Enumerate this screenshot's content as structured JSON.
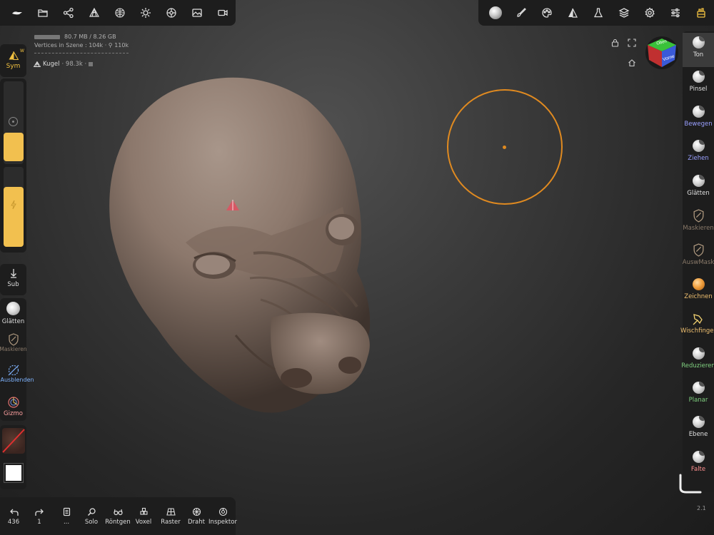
{
  "top_left_toolbar": [
    {
      "name": "logo-icon"
    },
    {
      "name": "folder-icon"
    },
    {
      "name": "scene-graph-icon"
    },
    {
      "name": "multires-icon"
    },
    {
      "name": "material-sphere-icon"
    },
    {
      "name": "light-icon"
    },
    {
      "name": "settings-wheel-icon"
    },
    {
      "name": "image-icon"
    },
    {
      "name": "video-icon"
    }
  ],
  "top_right_toolbar": [
    {
      "name": "matcap-sphere-icon"
    },
    {
      "name": "brush-icon"
    },
    {
      "name": "palette-icon"
    },
    {
      "name": "symmetry-icon"
    },
    {
      "name": "flask-icon"
    },
    {
      "name": "layers-icon"
    },
    {
      "name": "gear-icon"
    },
    {
      "name": "sliders-icon"
    },
    {
      "name": "tools-icon"
    }
  ],
  "info": {
    "memory": "80.7 MB / 8.26 GB",
    "vertices": "Vertices in Szene : 104k · ⚲ 110k"
  },
  "object": {
    "name": "Kugel",
    "count": "· 98.3k ·"
  },
  "sym": {
    "label": "Sym",
    "superscript": "W"
  },
  "slider_levels": {
    "radius_fraction": 0.55,
    "intensity_fraction": 0.75
  },
  "left_tools": [
    {
      "label": "Sub",
      "color": "#dddddd"
    },
    {
      "label": "Glätten",
      "color": "#dddddd"
    },
    {
      "label": "Maskieren",
      "color": "#8a7a6a"
    },
    {
      "label": "Ausblenden",
      "color": "#7fb4ff"
    },
    {
      "label": "Gizmo",
      "color": "#ffa0a0"
    }
  ],
  "right_tools": [
    {
      "label": "Ton",
      "color": "#e0e0e0",
      "ball": "grey"
    },
    {
      "label": "Pinsel",
      "color": "#e0e0e0",
      "ball": "grey"
    },
    {
      "label": "Bewegen",
      "color": "#9aa0ff",
      "ball": "grey"
    },
    {
      "label": "Ziehen",
      "color": "#9aa0ff",
      "ball": "grey"
    },
    {
      "label": "Glätten",
      "color": "#e0e0e0",
      "ball": "grey"
    },
    {
      "label": "Maskieren",
      "color": "#8a7a6a",
      "ball": "shield"
    },
    {
      "label": "AuswMask",
      "color": "#8a7a6a",
      "ball": "shield"
    },
    {
      "label": "Zeichnen",
      "color": "#f0c070",
      "ball": "orange"
    },
    {
      "label": "Wischfinger",
      "color": "#f0c070",
      "ball": "smudge"
    },
    {
      "label": "Reduzieren",
      "color": "#80d080",
      "ball": "grey"
    },
    {
      "label": "Planar",
      "color": "#80d080",
      "ball": "grey"
    },
    {
      "label": "Ebene",
      "color": "#e0e0e0",
      "ball": "grey"
    },
    {
      "label": "Falte",
      "color": "#ff9090",
      "ball": "grey"
    }
  ],
  "bottom_tools": [
    {
      "label": "436",
      "icon": "undo-icon"
    },
    {
      "label": "1",
      "icon": "redo-icon"
    },
    {
      "label": "...",
      "icon": "notebook-icon"
    },
    {
      "label": "Solo",
      "icon": "magnifier-icon"
    },
    {
      "label": "Röntgen",
      "icon": "glasses-icon"
    },
    {
      "label": "Voxel",
      "icon": "voxel-icon"
    },
    {
      "label": "Raster",
      "icon": "grid-icon"
    },
    {
      "label": "Draht",
      "icon": "wireframe-icon"
    },
    {
      "label": "Inspektor",
      "icon": "inspector-icon"
    }
  ],
  "view_cube": {
    "top": "Oben",
    "front": "Vorne"
  },
  "version": "2.1",
  "colors": {
    "accent": "#f0c040",
    "brush_circle": "#e08a20",
    "clay": "#8f7b6e"
  }
}
